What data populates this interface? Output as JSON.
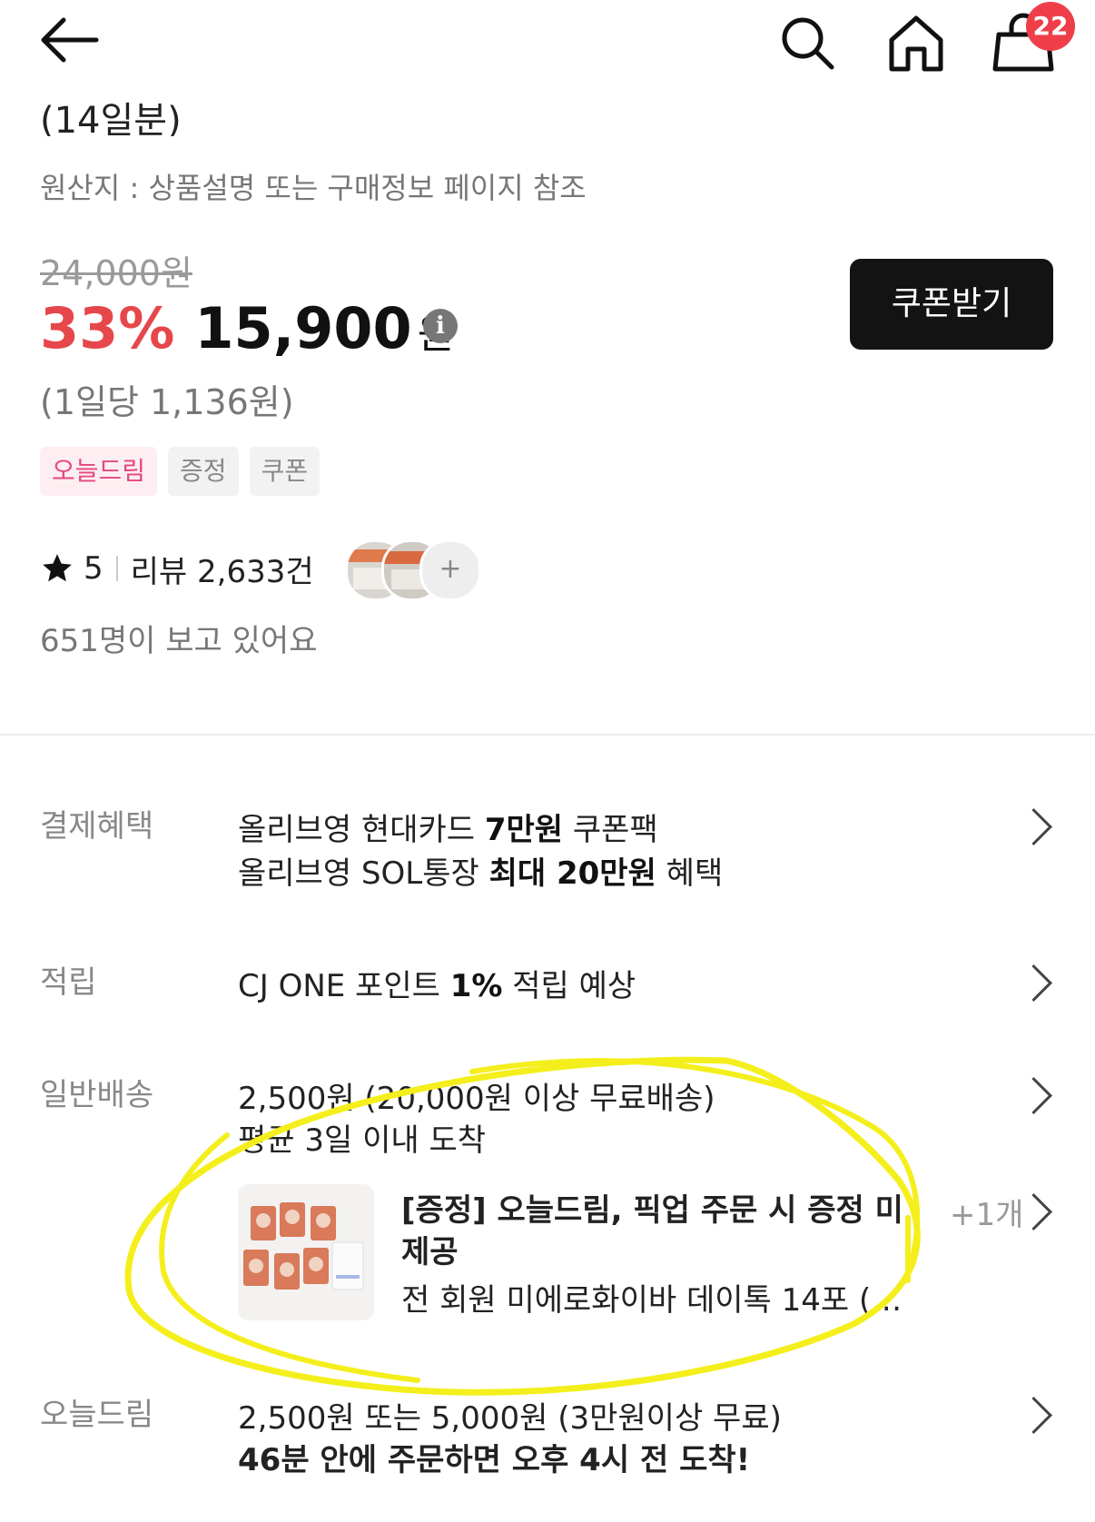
{
  "header": {
    "cart_count": "22",
    "colors": {
      "badge": "#ef3e4a"
    }
  },
  "product": {
    "title_tail": "(14일분)",
    "origin": "원산지 : 상품설명 또는 구매정보 페이지 참조",
    "original_price": "24,000원",
    "discount": "33%",
    "price": "15,900",
    "currency": "원",
    "per_day": "(1일당 1,136원)",
    "coupon_button": "쿠폰받기",
    "tags": [
      "오늘드림",
      "증정",
      "쿠폰"
    ],
    "rating": "5",
    "reviews": "리뷰 2,633건",
    "avatar_more": "+",
    "viewers": "651명이 보고 있어요",
    "colors": {
      "discount": "#e6474a",
      "tag_pink": "#e5487d"
    }
  },
  "benefits": {
    "payment": {
      "label": "결제혜택",
      "line1": {
        "pre": "올리브영 현대카드 ",
        "bold": "7만원",
        "post": " 쿠폰팩"
      },
      "line2": {
        "pre": "올리브영 SOL통장 ",
        "bold": "최대 20만원",
        "post": " 혜택"
      }
    },
    "points": {
      "label": "적립",
      "line": {
        "pre": "CJ ONE 포인트 ",
        "bold": "1%",
        "post": " 적립 예상"
      }
    },
    "shipping": {
      "label": "일반배송",
      "line1": "2,500원 (20,000원 이상 무료배송)",
      "line2": "평균 3일 이내 도착",
      "gift": {
        "title": "[증정] 오늘드림, 픽업 주문 시 증정 미제공",
        "subtitle": "전 회원 미에로화이바 데이톡 14포 (1...",
        "more": "+1개"
      }
    },
    "today": {
      "label": "오늘드림",
      "line1": "2,500원 또는 5,000원 (3만원이상 무료)",
      "line2": "46분 안에 주문하면 오후 4시 전 도착!"
    }
  }
}
